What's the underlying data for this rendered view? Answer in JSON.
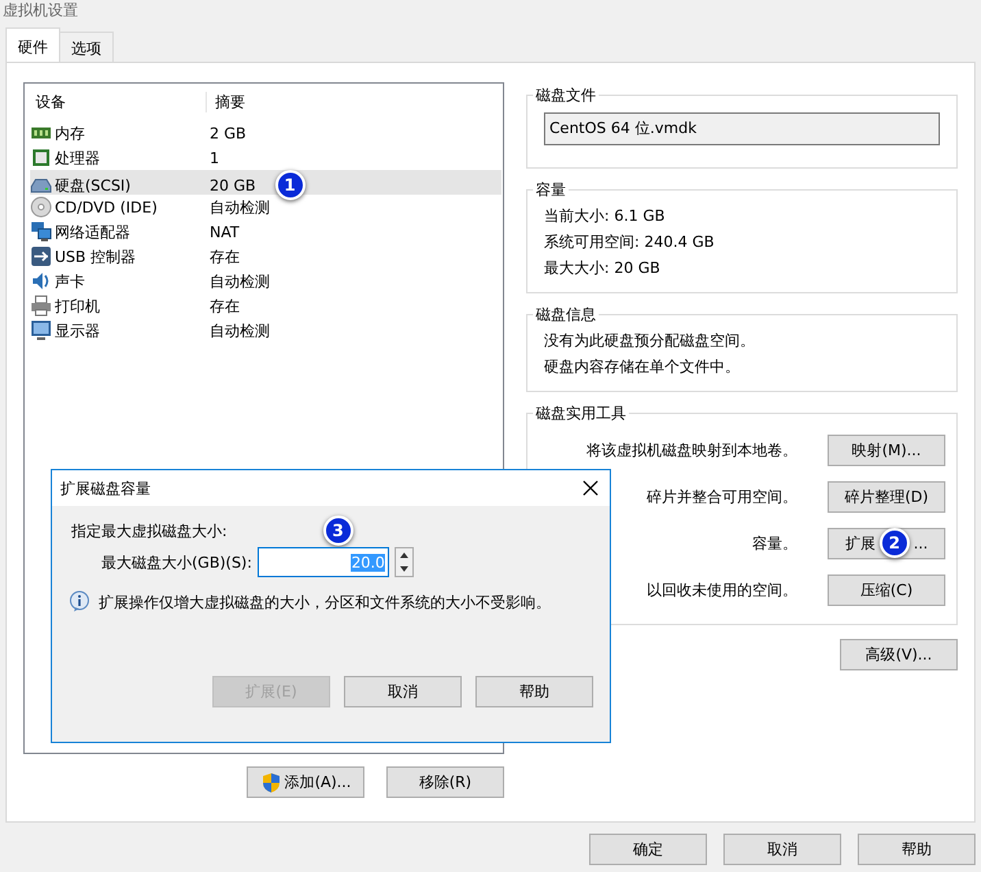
{
  "window": {
    "title": "虚拟机设置"
  },
  "tabs": [
    {
      "label": "硬件",
      "selected": true
    },
    {
      "label": "选项",
      "selected": false
    }
  ],
  "devices": {
    "columns": [
      "设备",
      "摘要"
    ],
    "rows": [
      {
        "kind": "memory",
        "name": "内存",
        "summary": "2 GB",
        "selected": false
      },
      {
        "kind": "cpu",
        "name": "处理器",
        "summary": "1",
        "selected": false
      },
      {
        "kind": "disk",
        "name": "硬盘(SCSI)",
        "summary": "20 GB",
        "selected": true,
        "marker": "1"
      },
      {
        "kind": "cd",
        "name": "CD/DVD (IDE)",
        "summary": "自动检测",
        "selected": false
      },
      {
        "kind": "network",
        "name": "网络适配器",
        "summary": "NAT",
        "selected": false
      },
      {
        "kind": "usb",
        "name": "USB 控制器",
        "summary": "存在",
        "selected": false
      },
      {
        "kind": "sound",
        "name": "声卡",
        "summary": "自动检测",
        "selected": false
      },
      {
        "kind": "printer",
        "name": "打印机",
        "summary": "存在",
        "selected": false
      },
      {
        "kind": "display",
        "name": "显示器",
        "summary": "自动检测",
        "selected": false
      }
    ],
    "buttons": [
      "添加(A)...",
      "移除(R)"
    ]
  },
  "disk_file": {
    "title": "磁盘文件",
    "value": "CentOS 64 位.vmdk"
  },
  "capacity": {
    "title": "容量",
    "lines": [
      "当前大小: 6.1 GB",
      "系统可用空间: 240.4 GB",
      "最大大小: 20 GB"
    ]
  },
  "disk_info": {
    "title": "磁盘信息",
    "lines": [
      "没有为此硬盘预分配磁盘空间。",
      "硬盘内容存储在单个文件中。"
    ]
  },
  "utilities": {
    "title": "磁盘实用工具",
    "rows": [
      {
        "text": "将该虚拟机磁盘映射到本地卷。",
        "button": "映射(M)..."
      },
      {
        "text": "碎片并整合可用空间。",
        "button": "碎片整理(D)"
      },
      {
        "text": "容量。",
        "button": "扩展",
        "button_tail": "...",
        "marker": "2"
      },
      {
        "text": "以回收未使用的空间。",
        "button": "压缩(C)"
      }
    ]
  },
  "advanced_button": "高级(V)...",
  "footer_buttons": [
    "确定",
    "取消",
    "帮助"
  ],
  "dialog": {
    "title": "扩展磁盘容量",
    "prompt": "指定最大虚拟磁盘大小:",
    "marker": "3",
    "field_label": "最大磁盘大小(GB)(S):",
    "value": "20.0",
    "value_selected": true,
    "info": "扩展操作仅增大虚拟磁盘的大小，分区和文件系统的大小不受影响。",
    "buttons": [
      {
        "label": "扩展(E)",
        "disabled": true
      },
      {
        "label": "取消",
        "disabled": false
      },
      {
        "label": "帮助",
        "disabled": false
      }
    ]
  }
}
